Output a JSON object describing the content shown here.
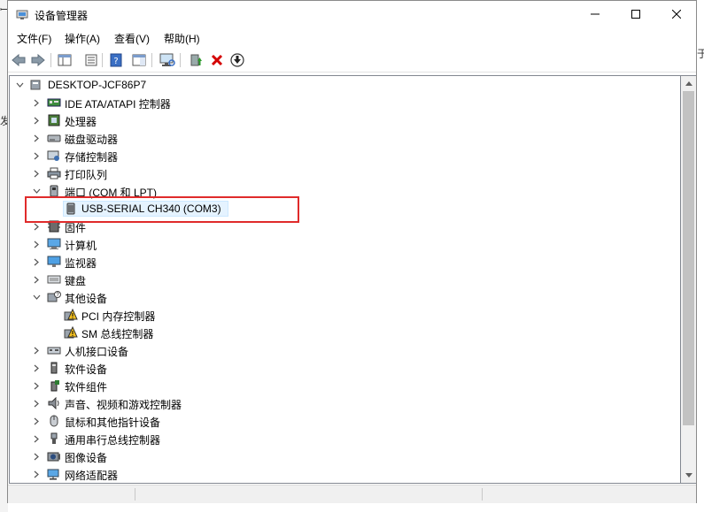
{
  "background": {
    "frag_left_top": "ꟷ",
    "frag_left_mid": "发",
    "frag_right": "于"
  },
  "window": {
    "title": "设备管理器",
    "icon": "device-manager-icon"
  },
  "menu": [
    {
      "label": "文件(F)"
    },
    {
      "label": "操作(A)"
    },
    {
      "label": "查看(V)"
    },
    {
      "label": "帮助(H)"
    }
  ],
  "toolbar": [
    "back-arrow-icon",
    "forward-arrow-icon",
    "show-hide-tree-icon",
    "properties-icon",
    "help-icon",
    "action-pane-icon",
    "scan-hardware-icon",
    "update-driver-icon",
    "uninstall-device-icon",
    "download-driver-icon"
  ],
  "tree": {
    "root": "DESKTOP-JCF86P7",
    "items": [
      {
        "label": "IDE ATA/ATAPI 控制器",
        "icon": "ide-controller-icon",
        "expanded": false,
        "level": 1
      },
      {
        "label": "处理器",
        "icon": "processor-icon",
        "expanded": false,
        "level": 1
      },
      {
        "label": "磁盘驱动器",
        "icon": "disk-drive-icon",
        "expanded": false,
        "level": 1
      },
      {
        "label": "存储控制器",
        "icon": "storage-controller-icon",
        "expanded": false,
        "level": 1
      },
      {
        "label": "打印队列",
        "icon": "printer-icon",
        "expanded": false,
        "level": 1
      },
      {
        "label": "端口 (COM 和 LPT)",
        "icon": "port-icon",
        "expanded": true,
        "level": 1
      },
      {
        "label": "USB-SERIAL CH340 (COM3)",
        "icon": "serial-port-icon",
        "level": 2,
        "selected": true
      },
      {
        "label": "固件",
        "icon": "firmware-icon",
        "expanded": false,
        "level": 1
      },
      {
        "label": "计算机",
        "icon": "computer-icon",
        "expanded": false,
        "level": 1
      },
      {
        "label": "监视器",
        "icon": "monitor-icon",
        "expanded": false,
        "level": 1
      },
      {
        "label": "键盘",
        "icon": "keyboard-icon",
        "expanded": false,
        "level": 1
      },
      {
        "label": "其他设备",
        "icon": "other-devices-icon",
        "expanded": true,
        "level": 1
      },
      {
        "label": "PCI 内存控制器",
        "icon": "warning-device-icon",
        "level": 2
      },
      {
        "label": "SM 总线控制器",
        "icon": "warning-device-icon",
        "level": 2
      },
      {
        "label": "人机接口设备",
        "icon": "hid-icon",
        "expanded": false,
        "level": 1
      },
      {
        "label": "软件设备",
        "icon": "software-device-icon",
        "expanded": false,
        "level": 1
      },
      {
        "label": "软件组件",
        "icon": "software-component-icon",
        "expanded": false,
        "level": 1
      },
      {
        "label": "声音、视频和游戏控制器",
        "icon": "audio-icon",
        "expanded": false,
        "level": 1
      },
      {
        "label": "鼠标和其他指针设备",
        "icon": "mouse-icon",
        "expanded": false,
        "level": 1
      },
      {
        "label": "通用串行总线控制器",
        "icon": "usb-icon",
        "expanded": false,
        "level": 1
      },
      {
        "label": "图像设备",
        "icon": "camera-icon",
        "expanded": false,
        "level": 1
      },
      {
        "label": "网络适配器",
        "icon": "network-adapter-icon",
        "expanded": false,
        "level": 1
      }
    ]
  },
  "colors": {
    "selection": "#e5f3ff",
    "highlight_box": "#e02b2b"
  }
}
